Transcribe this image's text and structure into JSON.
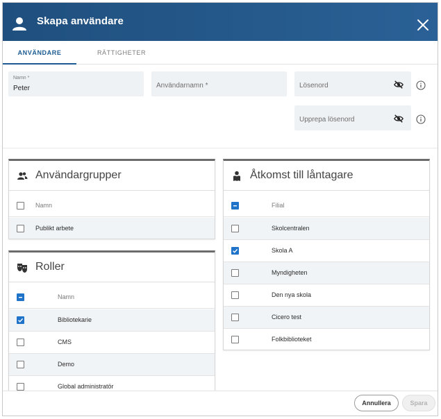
{
  "dialog": {
    "title": "Skapa användare",
    "icons": {
      "header": "user-icon",
      "close": "close-icon"
    }
  },
  "tabs": [
    {
      "label": "ANVÄNDARE",
      "active": true
    },
    {
      "label": "RÄTTIGHETER",
      "active": false
    }
  ],
  "form": {
    "name": {
      "label": "Namn *",
      "value": "Peter"
    },
    "username": {
      "placeholder": "Användarnamn *"
    },
    "password": {
      "placeholder": "Lösenord"
    },
    "password_repeat": {
      "placeholder": "Upprepa lösenord"
    },
    "icons": {
      "visibility": "eye-off-icon",
      "info": "info-icon"
    }
  },
  "user_groups": {
    "title": "Användargrupper",
    "icon": "group-icon",
    "header": "Namn",
    "rows": [
      {
        "label": "Publikt arbete",
        "checked": false
      }
    ]
  },
  "roles": {
    "title": "Roller",
    "icon": "masks-icon",
    "header": "Namn",
    "header_state": "partial",
    "rows": [
      {
        "label": "Bibliotekarie",
        "checked": true
      },
      {
        "label": "CMS",
        "checked": false
      },
      {
        "label": "Demo",
        "checked": false
      },
      {
        "label": "Global administratör",
        "checked": false
      }
    ]
  },
  "borrower_access": {
    "title": "Åtkomst till låntagare",
    "icon": "reader-icon",
    "header": "Filial",
    "header_state": "partial",
    "rows": [
      {
        "label": "Skolcentralen",
        "checked": false
      },
      {
        "label": "Skola A",
        "checked": true
      },
      {
        "label": "Myndigheten",
        "checked": false
      },
      {
        "label": "Den nya skola",
        "checked": false
      },
      {
        "label": "Cicero test",
        "checked": false
      },
      {
        "label": "Folkbiblioteket",
        "checked": false
      }
    ]
  },
  "footer": {
    "cancel_label": "Annullera",
    "save_label": "Spara",
    "save_enabled": false
  },
  "colors": {
    "header_bg": "#24578a",
    "accent": "#1c5b92",
    "checkbox": "#1f73c8",
    "row_alt": "#f1f4f7"
  }
}
